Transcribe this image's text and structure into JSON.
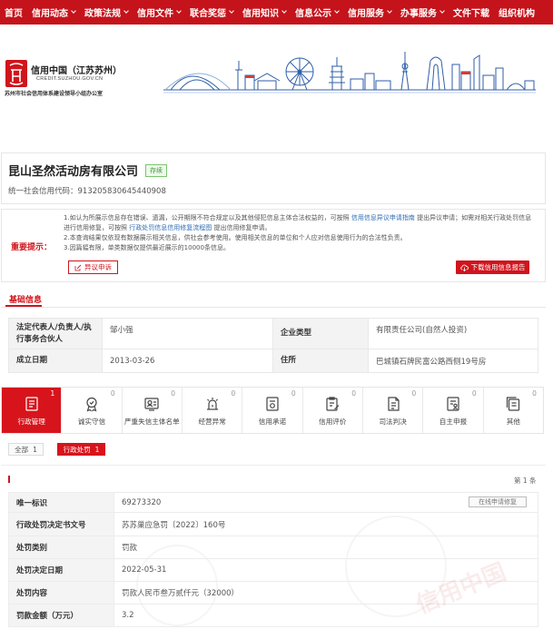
{
  "colors": {
    "brand_red": "#c5131b",
    "accent_red": "#d7141c",
    "link_blue": "#2f6db5",
    "status_green": "#52a447",
    "skyline_blue": "#2f5ea8"
  },
  "nav": {
    "items": [
      {
        "label": "首页"
      },
      {
        "label": "信用动态",
        "icon": "chevron-down-icon"
      },
      {
        "label": "政策法规",
        "icon": "chevron-down-icon"
      },
      {
        "label": "信用文件",
        "icon": "chevron-down-icon"
      },
      {
        "label": "联合奖惩",
        "icon": "chevron-down-icon"
      },
      {
        "label": "信用知识",
        "icon": "chevron-down-icon"
      },
      {
        "label": "信息公示",
        "icon": "chevron-down-icon"
      },
      {
        "label": "信用服务",
        "icon": "chevron-down-icon"
      },
      {
        "label": "办事服务",
        "icon": "chevron-down-icon"
      },
      {
        "label": "文件下载"
      },
      {
        "label": "组织机构"
      }
    ]
  },
  "header": {
    "logo_icon": "credit-china-seal-logo",
    "site_title": "信用中国（江苏苏州）",
    "site_domain": "CREDIT.SUZHOU.GOV.CN",
    "org_name": "苏州市社会信用体系建设领导小组办公室",
    "banner": "suzhou-skyline-illustration"
  },
  "company": {
    "name": "昆山圣然活动房有限公司",
    "status": "存续",
    "credit_code_label": "统一社会信用代码：",
    "credit_code": "913205830645440908"
  },
  "notice": {
    "label": "重要提示：",
    "line1_part1": "1.如认为所展示信息存在错误、遗漏，公开期限不符合规定以及其他侵犯信息主体合法权益的，可按照",
    "line1_link1": "信用信息异议申请指南",
    "line1_part2": "提出异议申请；如需对相关行政处罚信息进行信用修复，可按照",
    "line1_link2": "行政处罚信息信用修复流程图",
    "line1_part3": "提出信用修复申请。",
    "line2": "2.本查询结果仅依现有数据展示相关信息，供社会参考使用。使用相关信息的单位和个人应对信息使用行为的合法性负责。",
    "line3": "3.因篇幅有限，单类数据仅提供最近展示的10000条信息。",
    "objection_button": "异议申诉",
    "objection_icon": "edit-icon",
    "download_button": "下载信用信息报告",
    "download_icon": "download-icon"
  },
  "basic_info": {
    "section_title": "基础信息",
    "rows": [
      {
        "label1": "法定代表人/负责人/执行事务合伙人",
        "value1": "邹小强",
        "label2": "企业类型",
        "value2": "有限责任公司(自然人投资)"
      },
      {
        "label1": "成立日期",
        "value1": "2013-03-26",
        "label2": "住所",
        "value2": "巴城镇石牌民富公路西侧19号房"
      }
    ]
  },
  "tabs": [
    {
      "label": "行政管理",
      "count": "1",
      "icon": "document-list-icon",
      "active": true
    },
    {
      "label": "诚实守信",
      "count": "0",
      "icon": "honesty-badge-icon"
    },
    {
      "label": "严重失信主体名单",
      "count": "0",
      "icon": "person-card-icon"
    },
    {
      "label": "经营异常",
      "count": "0",
      "icon": "warning-beacon-icon"
    },
    {
      "label": "信用承诺",
      "count": "0",
      "icon": "commitment-document-icon"
    },
    {
      "label": "信用评价",
      "count": "0",
      "icon": "evaluation-clipboard-icon"
    },
    {
      "label": "司法判决",
      "count": "0",
      "icon": "judgment-document-icon"
    },
    {
      "label": "自主申报",
      "count": "0",
      "icon": "declaration-document-icon"
    },
    {
      "label": "其他",
      "count": "0",
      "icon": "other-documents-icon"
    }
  ],
  "filters": [
    {
      "label": "全部",
      "count": "1"
    },
    {
      "label": "行政处罚",
      "count": "1",
      "active": true
    }
  ],
  "record": {
    "index_label": "第 1 条",
    "repair_button": "在线申请修复",
    "rows": [
      {
        "label": "唯一标识",
        "value": "69273320"
      },
      {
        "label": "行政处罚决定书文号",
        "value": "苏苏巢应急罚〔2022〕160号"
      },
      {
        "label": "处罚类别",
        "value": "罚款"
      },
      {
        "label": "处罚决定日期",
        "value": "2022-05-31"
      },
      {
        "label": "处罚内容",
        "value": "罚款人民币叁万贰仟元（32000）"
      },
      {
        "label": "罚款金额（万元）",
        "value": "3.2"
      }
    ],
    "watermark": "信用中国"
  }
}
